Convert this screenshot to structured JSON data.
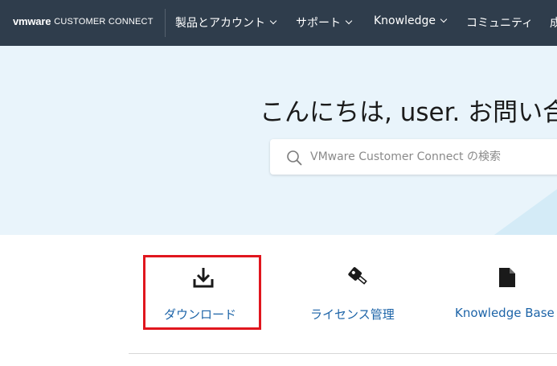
{
  "header": {
    "brand_logo": "vmware",
    "brand_name": "CUSTOMER CONNECT",
    "nav": [
      {
        "label": "製品とアカウント",
        "dropdown": true
      },
      {
        "label": "サポート",
        "dropdown": true
      },
      {
        "label": "Knowledge",
        "dropdown": true
      },
      {
        "label": "コミュニティ",
        "dropdown": false
      },
      {
        "label": "成",
        "dropdown": false
      }
    ]
  },
  "hero": {
    "greeting": "こんにちは, user. お問い合",
    "search": {
      "placeholder": "VMware Customer Connect の検索",
      "icon": "search-icon"
    }
  },
  "quick_links": [
    {
      "label": "ダウンロード",
      "icon": "download-icon",
      "highlighted": true
    },
    {
      "label": "ライセンス管理",
      "icon": "key-icon",
      "highlighted": false
    },
    {
      "label": "Knowledge Base",
      "icon": "document-icon",
      "highlighted": false
    }
  ],
  "colors": {
    "topbar": "#2f3d4c",
    "hero_background": "#e9f4fb",
    "link": "#1d64a8",
    "highlight_border": "#e0161e"
  }
}
